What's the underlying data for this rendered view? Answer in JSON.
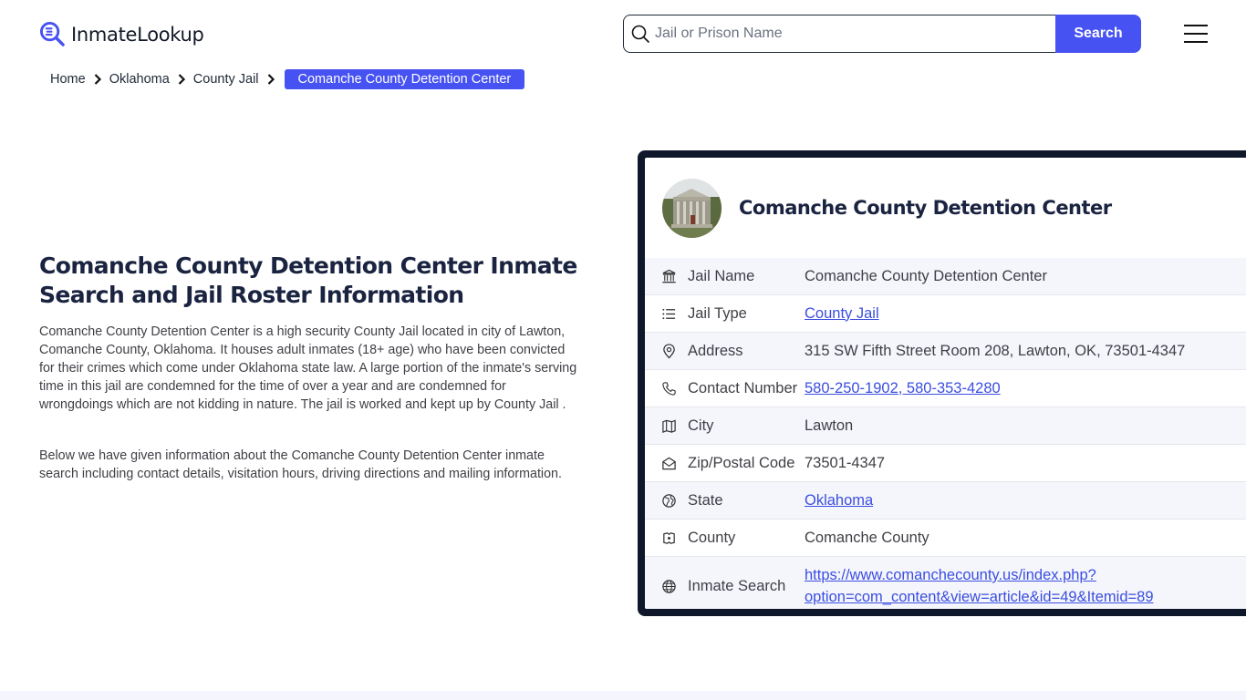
{
  "header": {
    "logo_text": "InmateLookup",
    "search_placeholder": "Jail or Prison Name",
    "search_value": "",
    "search_button": "Search",
    "menu_icon": "hamburger-icon"
  },
  "breadcrumb": {
    "items": [
      "Home",
      "Oklahoma",
      "County Jail"
    ],
    "current": "Comanche County Detention Center"
  },
  "main": {
    "title": "Comanche County Detention Center Inmate Search and Jail Roster Information",
    "paragraphs": [
      "Comanche County Detention Center is a high security County Jail located in city of Lawton, Comanche County, Oklahoma. It houses adult inmates (18+ age) who have been convicted for their crimes which come under Oklahoma state law. A large portion of the inmate's serving time in this jail are condemned for the time of over a year and are condemned for wrongdoings which are not kidding in nature. The jail is worked and kept up by County Jail .",
      "Below we have given information about the Comanche County Detention Center inmate search including contact details, visitation hours, driving directions and mailing information."
    ]
  },
  "card": {
    "title": "Comanche County Detention Center",
    "rows": [
      {
        "icon": "building-icon",
        "label": "Jail Name",
        "value": "Comanche County Detention Center",
        "link": false
      },
      {
        "icon": "list-icon",
        "label": "Jail Type",
        "value": "County Jail",
        "link": true
      },
      {
        "icon": "map-pin-icon",
        "label": "Address",
        "value": "315 SW Fifth Street Room 208, Lawton, OK, 73501-4347",
        "link": false
      },
      {
        "icon": "phone-icon",
        "label": "Contact Number",
        "value": "580-250-1902, 580-353-4280",
        "link": true
      },
      {
        "icon": "map-icon",
        "label": "City",
        "value": "Lawton",
        "link": false
      },
      {
        "icon": "mail-icon",
        "label": "Zip/Postal Code",
        "value": "73501-4347",
        "link": false
      },
      {
        "icon": "globe-region-icon",
        "label": "State",
        "value": "Oklahoma",
        "link": true
      },
      {
        "icon": "county-icon",
        "label": "County",
        "value": "Comanche County",
        "link": false
      },
      {
        "icon": "globe-icon",
        "label": "Inmate Search",
        "value": "https://www.comanchecounty.us/index.php?option=com_content&view=article&id=49&Itemid=89",
        "value_line1": "https://www.comanchecounty.us/index.php?",
        "value_line2": "option=com_content&view=article&id=49&Itemid=89",
        "link": true
      }
    ]
  },
  "colors": {
    "accent": "#4652f2",
    "card_border": "#0f172a",
    "link": "#3b4ee0",
    "title": "#1a2340"
  }
}
